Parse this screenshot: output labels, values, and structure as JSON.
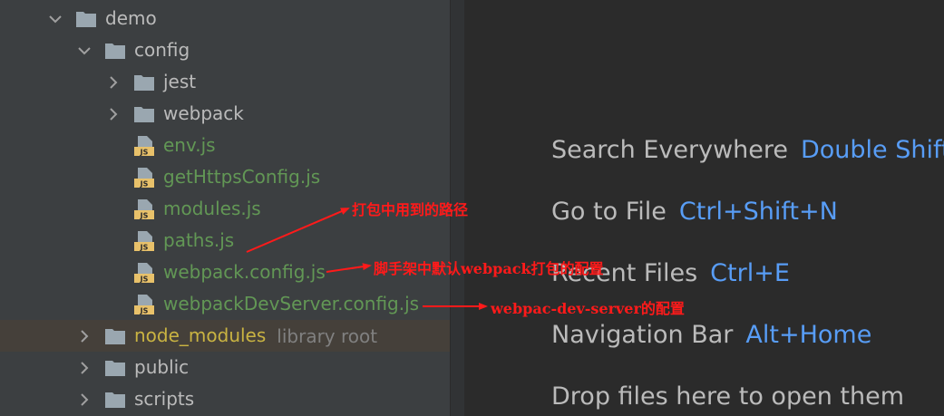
{
  "tree": {
    "items": [
      {
        "label": "demo",
        "kind": "folder",
        "state": "open",
        "indent": 0
      },
      {
        "label": "config",
        "kind": "folder",
        "state": "open",
        "indent": 1
      },
      {
        "label": "jest",
        "kind": "folder",
        "state": "closed",
        "indent": 2
      },
      {
        "label": "webpack",
        "kind": "folder",
        "state": "closed",
        "indent": 2
      },
      {
        "label": "env.js",
        "kind": "js",
        "indent": 2
      },
      {
        "label": "getHttpsConfig.js",
        "kind": "js",
        "indent": 2
      },
      {
        "label": "modules.js",
        "kind": "js",
        "indent": 2
      },
      {
        "label": "paths.js",
        "kind": "js",
        "indent": 2
      },
      {
        "label": "webpack.config.js",
        "kind": "js",
        "indent": 2
      },
      {
        "label": "webpackDevServer.config.js",
        "kind": "js",
        "indent": 2
      },
      {
        "label": "node_modules",
        "kind": "folder",
        "state": "closed",
        "indent": 1,
        "hint": "library root",
        "selected": true
      },
      {
        "label": "public",
        "kind": "folder",
        "state": "closed",
        "indent": 1
      },
      {
        "label": "scripts",
        "kind": "folder",
        "state": "closed",
        "indent": 1
      }
    ]
  },
  "editor": {
    "hints": [
      {
        "action": "Search Everywhere",
        "shortcut": "Double Shift"
      },
      {
        "action": "Go to File",
        "shortcut": "Ctrl+Shift+N"
      },
      {
        "action": "Recent Files",
        "shortcut": "Ctrl+E"
      },
      {
        "action": "Navigation Bar",
        "shortcut": "Alt+Home"
      },
      {
        "action": "Drop files here to open them",
        "shortcut": ""
      }
    ]
  },
  "annotations": [
    "打包中用到的路径",
    "脚手架中默认webpack打包的配置",
    "webpac-dev-server的配置"
  ],
  "colors": {
    "panel_bg": "#3c3f41",
    "editor_bg": "#2b2b2b",
    "text": "#bbbbbb",
    "js_file": "#629755",
    "excluded": "#c9b342",
    "shortcut": "#589df6",
    "annotation": "#ff1a1a"
  }
}
